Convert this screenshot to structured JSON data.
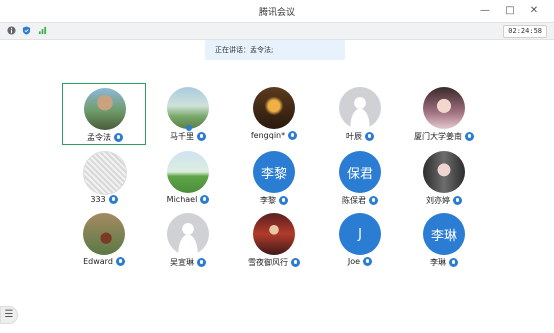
{
  "window": {
    "title": "腾讯会议",
    "minimize_glyph": "—",
    "maximize_glyph": "□",
    "close_glyph": "✕"
  },
  "statusbar": {
    "icons": [
      "info-icon",
      "shield-icon",
      "signal-icon"
    ],
    "timer": "02:24:58"
  },
  "banner": {
    "speaking_text": "正在讲话：孟令法;"
  },
  "colors": {
    "accent": "#2b7cd3",
    "active_border": "#2f9e63",
    "banner_bg": "#e8f2fc"
  },
  "participants": [
    {
      "name": "孟令法",
      "avatar_text": "",
      "active": true
    },
    {
      "name": "马千里",
      "avatar_text": ""
    },
    {
      "name": "fengqin*",
      "avatar_text": ""
    },
    {
      "name": "叶辰",
      "avatar_text": ""
    },
    {
      "name": "厦门大学姜南",
      "avatar_text": ""
    },
    {
      "name": "333",
      "avatar_text": ""
    },
    {
      "name": "Michael",
      "avatar_text": ""
    },
    {
      "name": "李黎",
      "avatar_text": "李黎"
    },
    {
      "name": "陈保君",
      "avatar_text": "保君"
    },
    {
      "name": "刘亦婷",
      "avatar_text": ""
    },
    {
      "name": "Edward",
      "avatar_text": ""
    },
    {
      "name": "吴宣琳",
      "avatar_text": ""
    },
    {
      "name": "雪夜御风行",
      "avatar_text": ""
    },
    {
      "name": "Joe",
      "avatar_text": "J"
    },
    {
      "name": "李琳",
      "avatar_text": "李琳"
    }
  ],
  "list_button_glyph": "☰"
}
